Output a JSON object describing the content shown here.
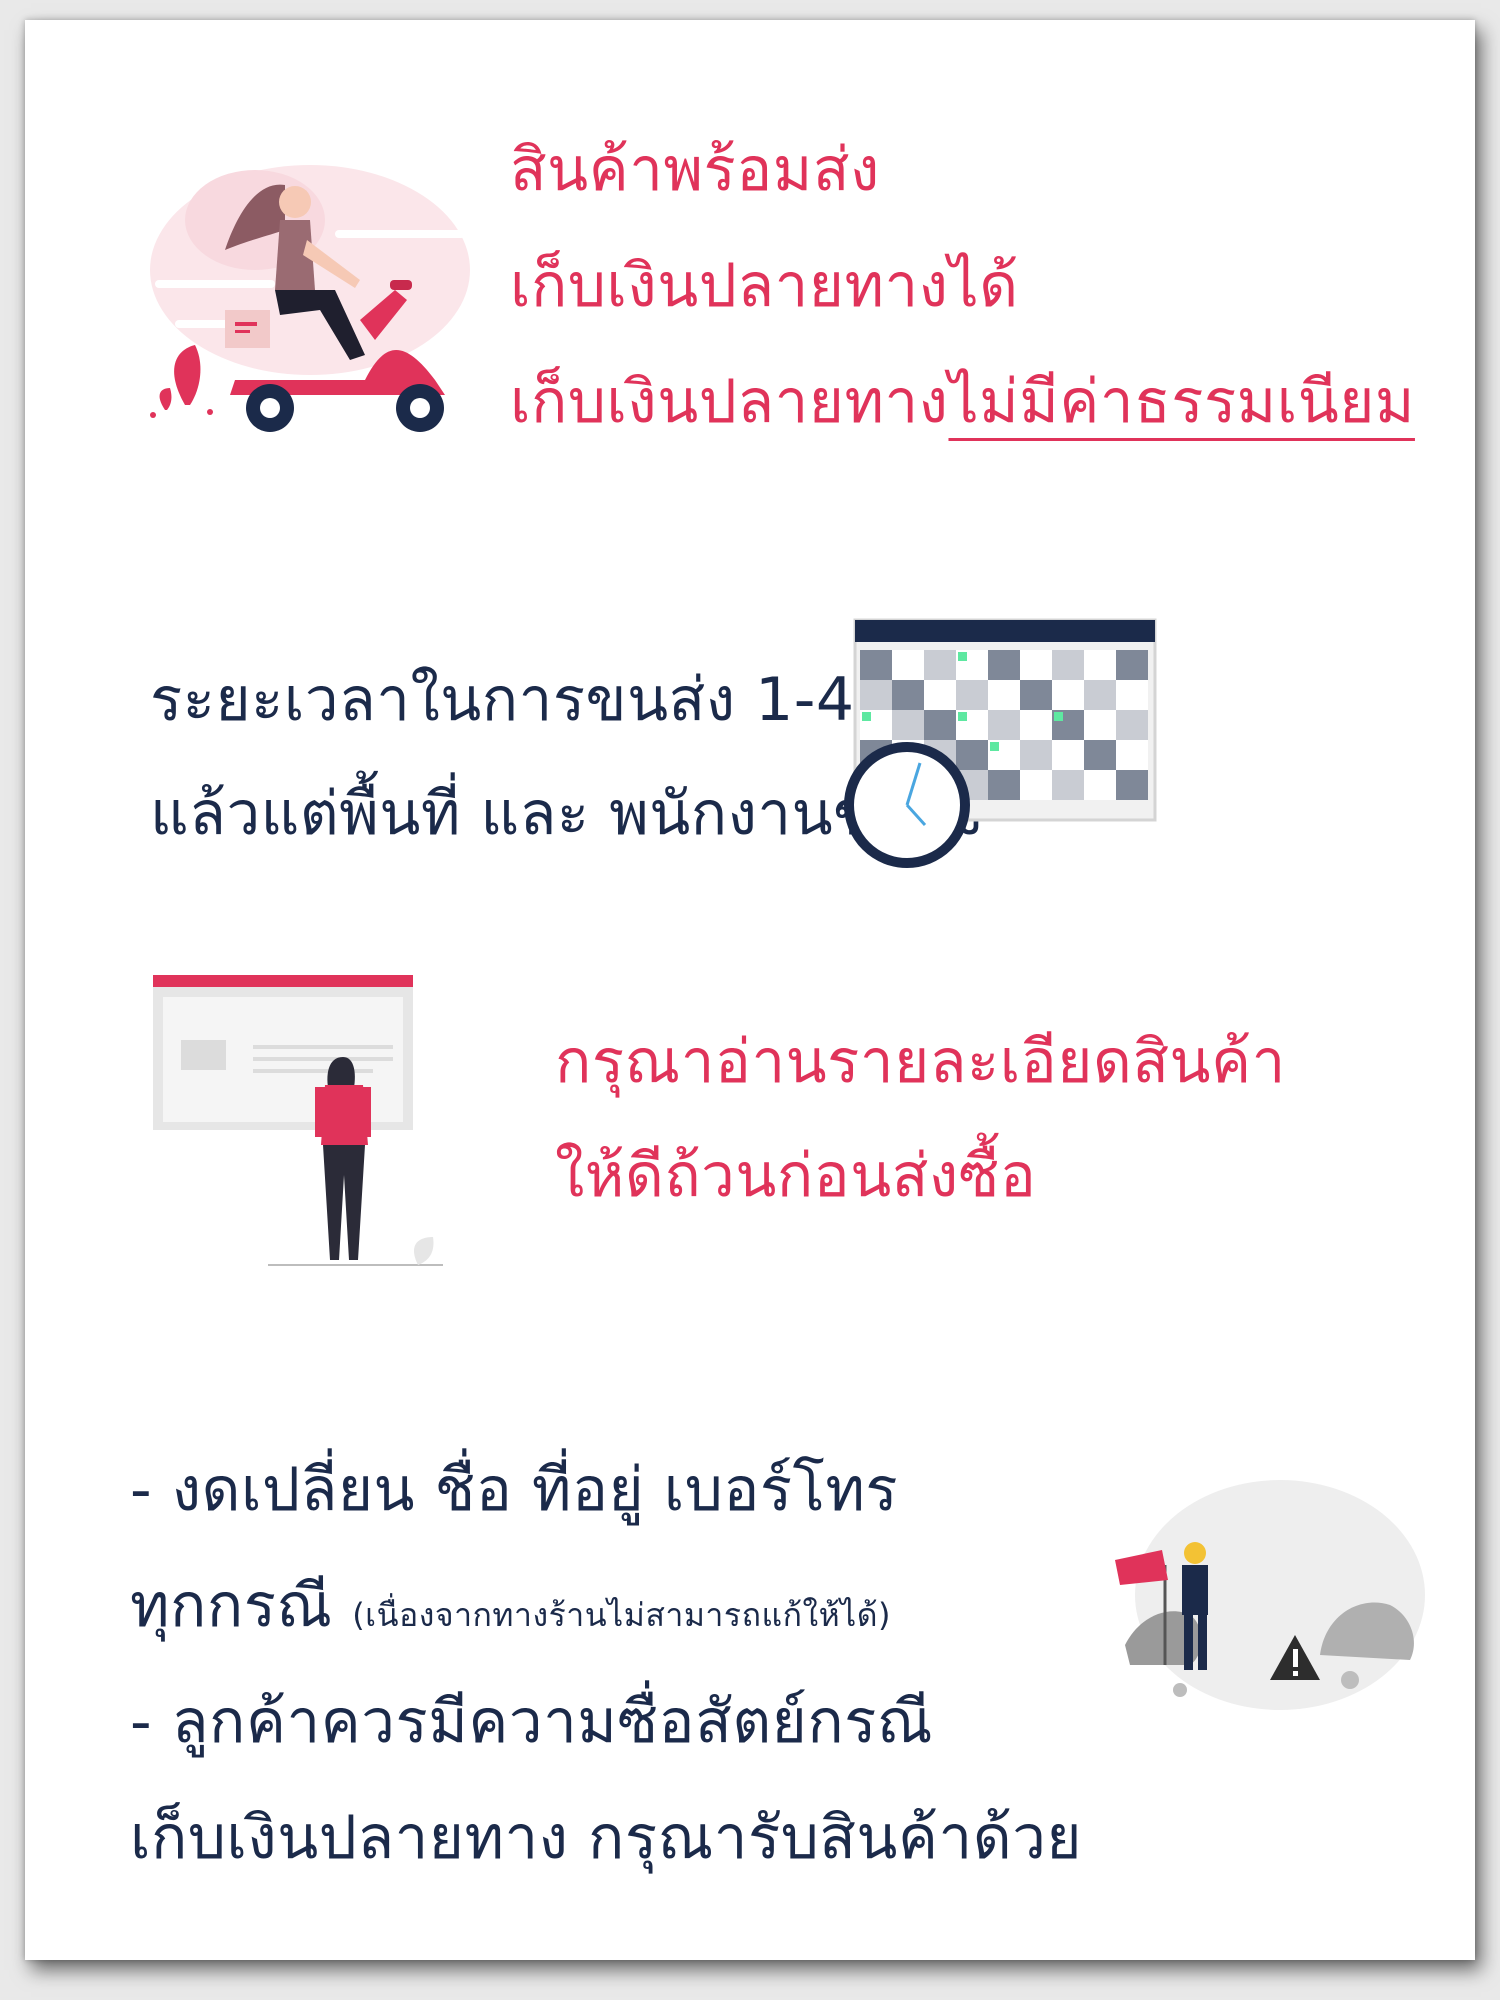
{
  "section1": {
    "line1": "สินค้าพร้อมส่ง",
    "line2": "เก็บเงินปลายทางได้",
    "line3_prefix": "เก็บเงินปลายทาง",
    "line3_underlined": "ไม่มีค่าธรรมเนียม"
  },
  "section2": {
    "line1": "ระยะเวลาในการขนส่ง 1-4 วัน",
    "line2": "แล้วแต่พื้นที่ และ พนักงานขนส่ง"
  },
  "section3": {
    "line1": "กรุณาอ่านรายละเอียดสินค้า",
    "line2": "ให้ดีถ้วนก่อนส่งซื้อ"
  },
  "section4": {
    "line1": "- งดเปลี่ยน ชื่อ ที่อยู่ เบอร์โทร",
    "line2": "ทุกกรณี",
    "line2_note": "(เนื่องจากทางร้านไม่สามารถแก้ให้ได้)",
    "line3": "- ลูกค้าควรมีความซื่อสัตย์กรณี",
    "line4": "เก็บเงินปลายทาง กรุณารับสินค้าด้วย"
  },
  "colors": {
    "accent_pink": "#e0335a",
    "text_navy": "#1b2a4a",
    "calendar_header": "#1b2a4a",
    "calendar_dot": "#5ee8a1"
  },
  "illustrations": {
    "scooter": "woman-on-scooter-delivery-icon",
    "calendar": "calendar-clock-icon",
    "reader": "woman-reading-board-icon",
    "warning": "worker-warning-sign-icon"
  }
}
